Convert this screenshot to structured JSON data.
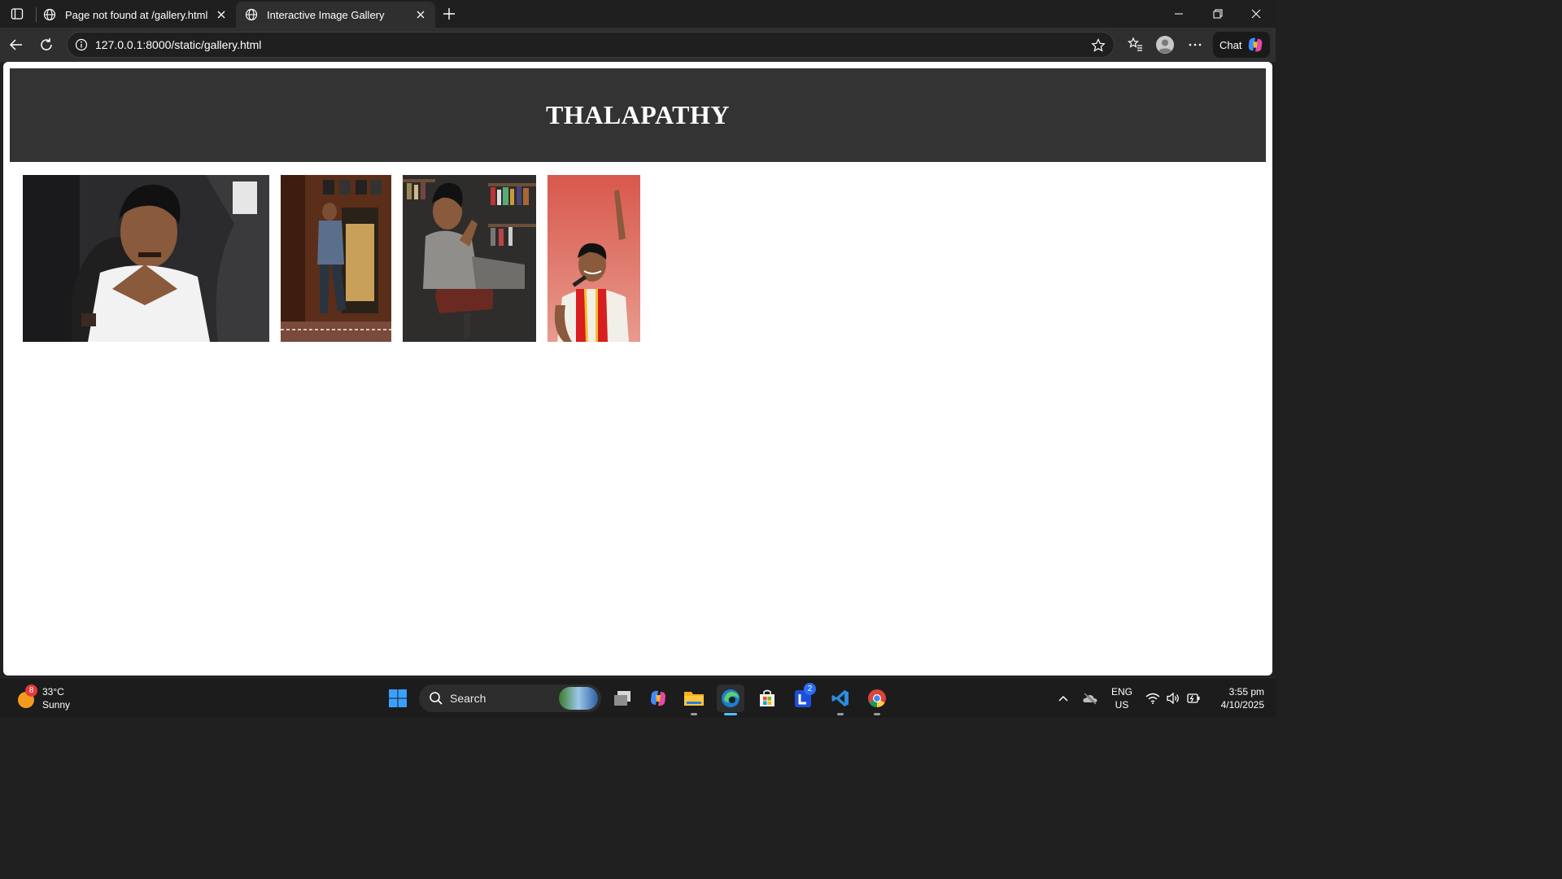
{
  "browser": {
    "tabs": [
      {
        "title": "Page not found at /gallery.html",
        "active": false
      },
      {
        "title": "Interactive Image Gallery",
        "active": true
      }
    ],
    "url": "127.0.0.1:8000/static/gallery.html",
    "chat_label": "Chat"
  },
  "page": {
    "header_title": "THALAPATHY",
    "header_bg": "#333333",
    "gallery": [
      {
        "name": "photo-1",
        "subject": "man in white shirt with clasped hands seated in car"
      },
      {
        "name": "photo-2",
        "subject": "man walking down stairs in wooden room"
      },
      {
        "name": "photo-3",
        "subject": "man in grey blazer seated in leather chair before bookshelf"
      },
      {
        "name": "photo-4",
        "subject": "man with microphone and red shawl on red background"
      }
    ]
  },
  "taskbar": {
    "weather": {
      "temp": "33°C",
      "condition": "Sunny",
      "badge": "8"
    },
    "search_label": "Search",
    "l_badge": "2",
    "lang_top": "ENG",
    "lang_bottom": "US",
    "time": "3:55 pm",
    "date": "4/10/2025"
  },
  "colors": {
    "accent": "#4cc2ff",
    "titlebar": "#1f1f1f",
    "toolbar": "#2f2f2f"
  }
}
